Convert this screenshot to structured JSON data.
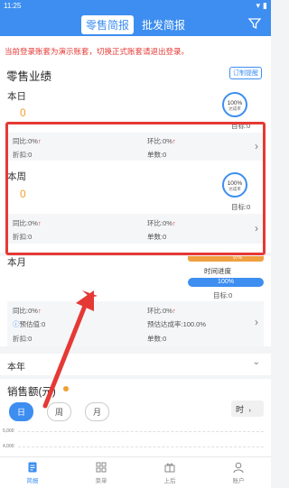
{
  "status_bar": {
    "time": "11:25"
  },
  "header": {
    "tabs": [
      "零售简报",
      "批发简报"
    ],
    "active_tab": 0
  },
  "notice": "当前登录账套为演示账套，切换正式账套请退出登录。",
  "retail": {
    "section_title": "零售业绩",
    "order_button": "订制提醒"
  },
  "today": {
    "label": "本日",
    "value": "0",
    "gauge_pct": "100%",
    "gauge_label": "达成率",
    "target": "目标:0",
    "yoy": "同比:0%",
    "mom": "环比:0%",
    "discount": "折扣:0",
    "orders": "单数:0"
  },
  "week": {
    "label": "本周",
    "value": "0",
    "gauge_pct": "100%",
    "gauge_label": "达成率",
    "target": "目标:0",
    "yoy": "同比:0%",
    "mom": "环比:0%",
    "discount": "折扣:0",
    "orders": "单数:0"
  },
  "month": {
    "label": "本月",
    "value": "0",
    "orange_value": "97%",
    "progress_label": "时间进度",
    "progress_pct": "100%",
    "target": "目标:0",
    "yoy": "同比:0%",
    "mom": "环比:0%",
    "estimate": "预估值:0",
    "estimate_rate": "预估达成率:100.0%",
    "discount": "折扣:0",
    "orders": "单数:0"
  },
  "year": {
    "label": "本年"
  },
  "sales": {
    "title": "销售额(元)",
    "segments": [
      "日",
      "周",
      "月"
    ],
    "active_segment": 0,
    "time_select": "时",
    "y_axis": [
      "5,000",
      "4,000"
    ]
  },
  "nav": {
    "items": [
      "简报",
      "菜单",
      "上后",
      "账户"
    ],
    "active": 0
  },
  "colors": {
    "primary": "#3d8ef0",
    "accent_red": "#e53935",
    "orange": "#f0a030"
  }
}
